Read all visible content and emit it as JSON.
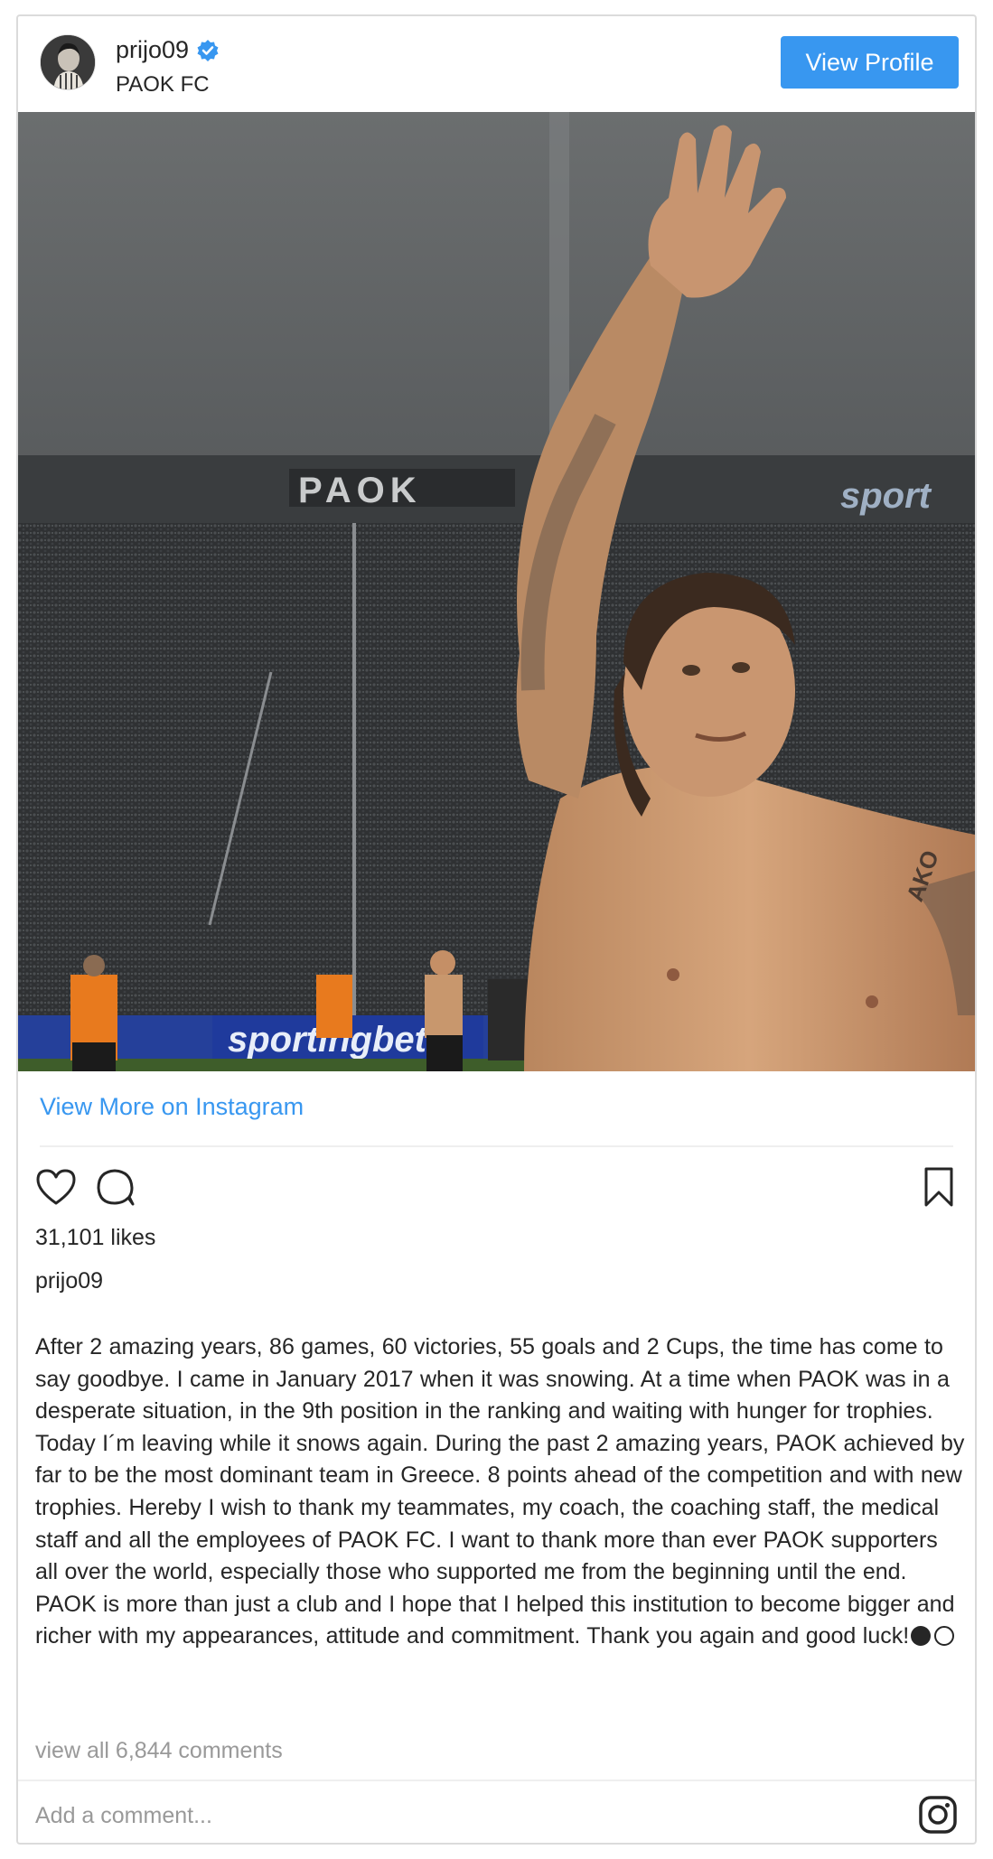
{
  "post": {
    "username": "prijo09",
    "location": "PAOK FC",
    "view_profile_label": "View Profile",
    "view_more_label": "View More on Instagram",
    "likes": "31,101 likes",
    "caption_user": "prijo09",
    "caption_text": "After 2 amazing years, 86 games, 60 victories, 55 goals and 2 Cups, the time has come to say goodbye. I came in January 2017 when it was snowing. At a time when PAOK was in a desperate situation, in the 9th position in the ranking and waiting with hunger for trophies. Today I´m leaving while it snows again. During the past 2 amazing years, PAOK achieved by far to be the most dominant team in Greece. 8 points ahead of the competition and with new trophies. Hereby I wish to thank my teammates, my coach, the coaching staff, the medical staff and all the employees of PAOK FC. I want to thank more than ever PAOK supporters all over the world, especially those who supported me from the beginning until the end. PAOK is more than just a club and I hope that I helped this institution to become bigger and richer with my appearances, attitude and commitment. Thank you again and good luck!",
    "comments_link": "view all 6,844 comments",
    "comment_placeholder": "Add a comment...",
    "photo_text": {
      "stand_banner": "PAOK",
      "ad_board_right": "sport",
      "ad_board_front": "sportingbet",
      "tattoo": "AKO"
    }
  },
  "icons": {
    "verified": "verified-badge-icon",
    "like": "heart-icon",
    "comment": "comment-bubble-icon",
    "save": "bookmark-icon",
    "instagram": "instagram-logo-icon"
  },
  "colors": {
    "accent": "#3897f0",
    "text": "#262626",
    "muted": "#999999",
    "border": "#dbdbdb"
  }
}
